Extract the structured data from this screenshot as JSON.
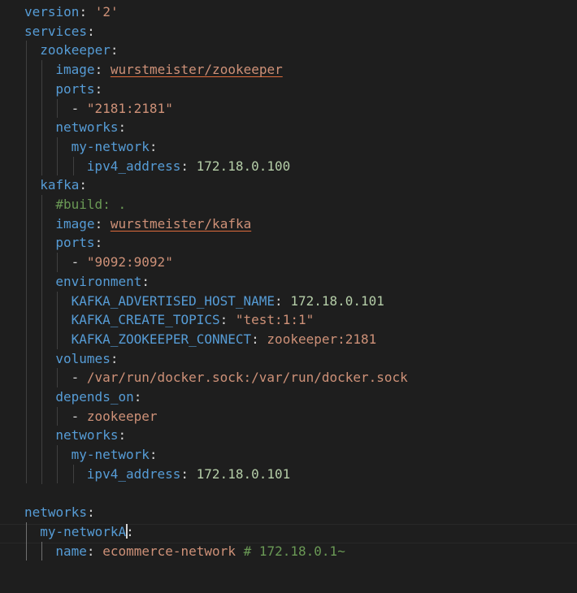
{
  "editor": {
    "lines": [
      {
        "indent": 0,
        "key": "version",
        "sep": ": ",
        "value": "'2'",
        "value_type": "str"
      },
      {
        "indent": 0,
        "key": "services",
        "sep": ":"
      },
      {
        "indent": 1,
        "key": "zookeeper",
        "sep": ":"
      },
      {
        "indent": 2,
        "key": "image",
        "sep": ": ",
        "value": "wurstmeister/zookeeper",
        "value_type": "str-underline"
      },
      {
        "indent": 2,
        "key": "ports",
        "sep": ":"
      },
      {
        "indent": 3,
        "dash": "- ",
        "value": "\"2181:2181\"",
        "value_type": "str"
      },
      {
        "indent": 2,
        "key": "networks",
        "sep": ":"
      },
      {
        "indent": 3,
        "key": "my-network",
        "sep": ":"
      },
      {
        "indent": 4,
        "key": "ipv4_address",
        "sep": ": ",
        "value": "172.18.0.100",
        "value_type": "num"
      },
      {
        "indent": 1,
        "key": "kafka",
        "sep": ":"
      },
      {
        "indent": 2,
        "comment": "#build: ."
      },
      {
        "indent": 2,
        "key": "image",
        "sep": ": ",
        "value": "wurstmeister/kafka",
        "value_type": "str-underline"
      },
      {
        "indent": 2,
        "key": "ports",
        "sep": ":"
      },
      {
        "indent": 3,
        "dash": "- ",
        "value": "\"9092:9092\"",
        "value_type": "str"
      },
      {
        "indent": 2,
        "key": "environment",
        "sep": ":"
      },
      {
        "indent": 3,
        "key": "KAFKA_ADVERTISED_HOST_NAME",
        "sep": ": ",
        "value": "172.18.0.101",
        "value_type": "num"
      },
      {
        "indent": 3,
        "key": "KAFKA_CREATE_TOPICS",
        "sep": ": ",
        "value": "\"test:1:1\"",
        "value_type": "str"
      },
      {
        "indent": 3,
        "key": "KAFKA_ZOOKEEPER_CONNECT",
        "sep": ": ",
        "value": "zookeeper:2181",
        "value_type": "str"
      },
      {
        "indent": 2,
        "key": "volumes",
        "sep": ":"
      },
      {
        "indent": 3,
        "dash": "- ",
        "value": "/var/run/docker.sock:/var/run/docker.sock",
        "value_type": "str"
      },
      {
        "indent": 2,
        "key": "depends_on",
        "sep": ":"
      },
      {
        "indent": 3,
        "dash": "- ",
        "value": "zookeeper",
        "value_type": "str"
      },
      {
        "indent": 2,
        "key": "networks",
        "sep": ":"
      },
      {
        "indent": 3,
        "key": "my-network",
        "sep": ":"
      },
      {
        "indent": 4,
        "key": "ipv4_address",
        "sep": ": ",
        "value": "172.18.0.101",
        "value_type": "num"
      },
      {
        "indent": 0,
        "blank": true
      },
      {
        "indent": 0,
        "key": "networks",
        "sep": ":"
      },
      {
        "indent": 1,
        "key": "my-networkA",
        "sep": ":",
        "cursor": true
      },
      {
        "indent": 2,
        "key": "name",
        "sep": ": ",
        "value": "ecommerce-network",
        "value_type": "str",
        "comment": "# 172.18.0.1~"
      }
    ]
  }
}
